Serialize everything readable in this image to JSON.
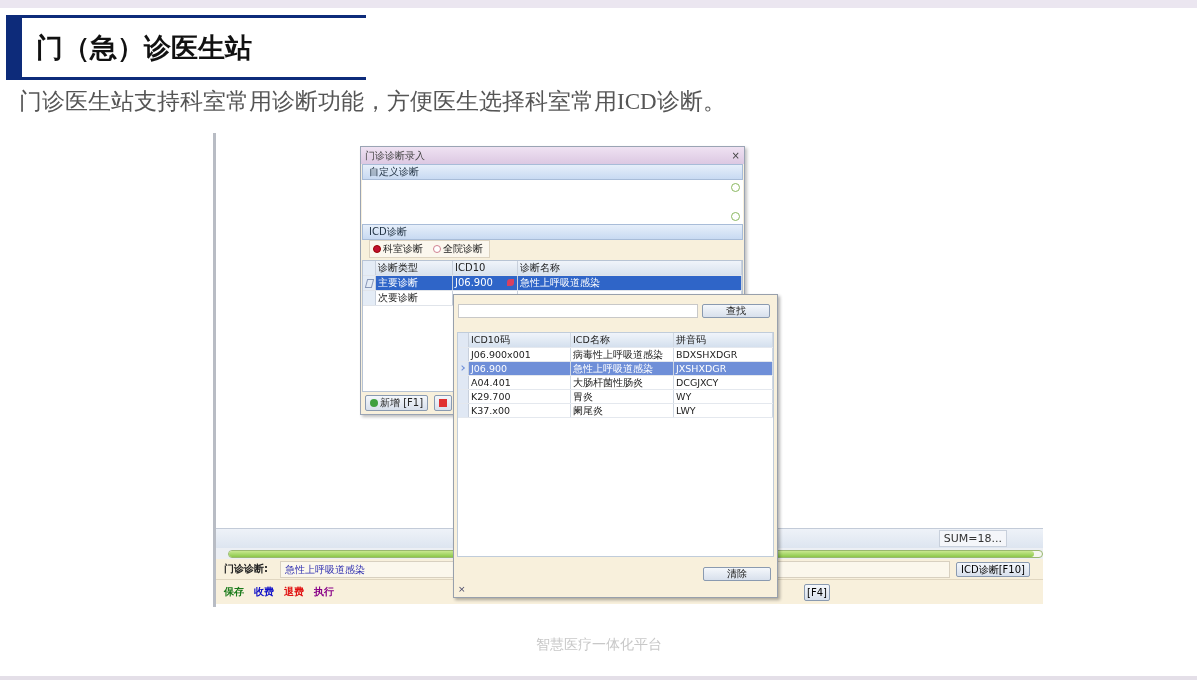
{
  "slide": {
    "title": "门（急）诊医生站",
    "subtitle": "门诊医生站支持科室常用诊断功能，方便医生选择科室常用ICD诊断。",
    "footer": "智慧医疗一体化平台"
  },
  "app": {
    "sum": "SUM=18...",
    "progress": {
      "level": 0.99
    },
    "diagnosis_label": "门诊诊断:",
    "diagnosis_value": "急性上呼吸道感染",
    "icd_button": "ICD诊断[F10]",
    "f4_button": "[F4]",
    "actions": [
      {
        "label": "保存",
        "color": "#1a7a1a"
      },
      {
        "label": "收费",
        "color": "#1010c8"
      },
      {
        "label": "退费",
        "color": "#e01010"
      },
      {
        "label": "执行",
        "color": "#880088"
      }
    ]
  },
  "dialog": {
    "title": "门诊诊断录入",
    "close": "×",
    "custom_section": "自定义诊断",
    "icd_section": "ICD诊断",
    "scopes": [
      {
        "label": "科室诊断",
        "selected": true
      },
      {
        "label": "全院诊断",
        "selected": false
      }
    ],
    "columns": [
      "诊断类型",
      "ICD10",
      "诊断名称"
    ],
    "rows": [
      {
        "type": "主要诊断",
        "icd": "J06.900",
        "name": "急性上呼吸道感染",
        "selected": true
      },
      {
        "type": "次要诊断",
        "selected": false
      }
    ],
    "add_button": "新增 [F1]"
  },
  "popup": {
    "search_button": "查找",
    "columns": [
      "ICD10码",
      "ICD名称",
      "拼音码"
    ],
    "rows": [
      {
        "code": "J06.900x001",
        "name": "病毒性上呼吸道感染",
        "pinyin": "BDXSHXDGR",
        "selected": false
      },
      {
        "code": "J06.900",
        "name": "急性上呼吸道感染",
        "pinyin": "JXSHXDGR",
        "selected": true
      },
      {
        "code": "A04.401",
        "name": "大肠杆菌性肠炎",
        "pinyin": "DCGJXCY",
        "selected": false
      },
      {
        "code": "K29.700",
        "name": "胃炎",
        "pinyin": "WY",
        "selected": false
      },
      {
        "code": "K37.x00",
        "name": "阑尾炎",
        "pinyin": "LWY",
        "selected": false
      }
    ],
    "clear_button": "清除",
    "close": "×"
  }
}
